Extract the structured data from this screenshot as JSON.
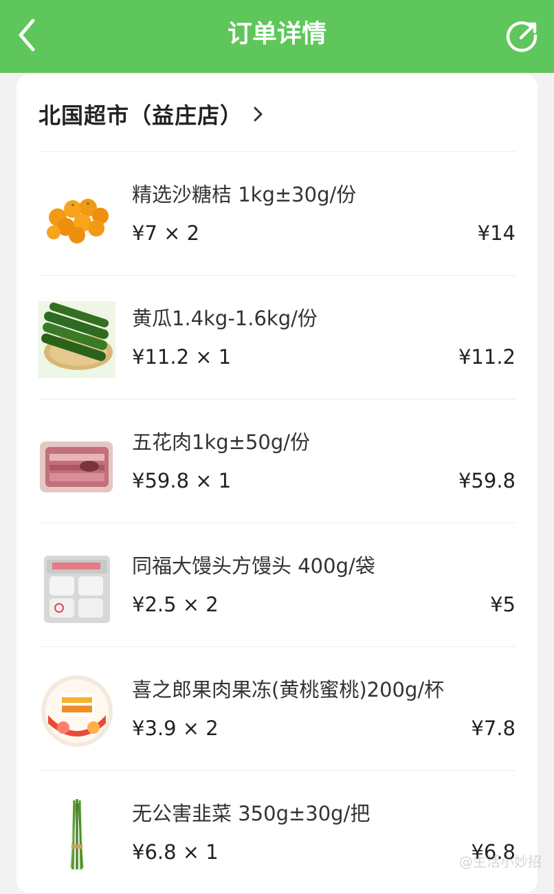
{
  "header": {
    "title": "订单详情",
    "background": "#5ec65a",
    "back_icon": "chevron-left-icon",
    "share_icon": "share-icon"
  },
  "store": {
    "name": "北国超市（益庄店）",
    "chevron_icon": "chevron-right-icon"
  },
  "items": [
    {
      "name": "精选沙糖桔 1kg±30g/份",
      "unit_price_qty": "¥7 × 2",
      "total": "¥14",
      "image": "mandarin-oranges"
    },
    {
      "name": "黄瓜1.4kg-1.6kg/份",
      "unit_price_qty": "¥11.2 × 1",
      "total": "¥11.2",
      "image": "cucumbers"
    },
    {
      "name": "五花肉1kg±50g/份",
      "unit_price_qty": "¥59.8 × 1",
      "total": "¥59.8",
      "image": "pork-belly"
    },
    {
      "name": "同福大馒头方馒头 400g/袋",
      "unit_price_qty": "¥2.5 × 2",
      "total": "¥5",
      "image": "steamed-buns-bag"
    },
    {
      "name": "喜之郎果肉果冻(黄桃蜜桃)200g/杯",
      "unit_price_qty": "¥3.9 × 2",
      "total": "¥7.8",
      "image": "jelly-cup"
    },
    {
      "name": "无公害韭菜 350g±30g/把",
      "unit_price_qty": "¥6.8 × 1",
      "total": "¥6.8",
      "image": "chives-bundle"
    }
  ],
  "watermark": "@生活小妙招"
}
